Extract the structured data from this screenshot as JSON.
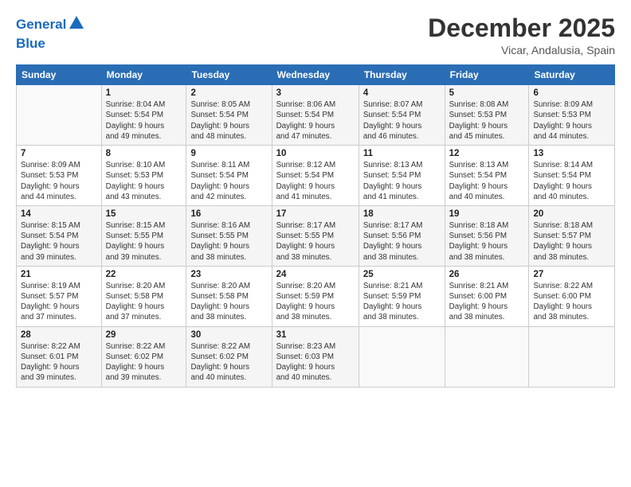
{
  "header": {
    "logo_line1": "General",
    "logo_line2": "Blue",
    "month": "December 2025",
    "location": "Vicar, Andalusia, Spain"
  },
  "weekdays": [
    "Sunday",
    "Monday",
    "Tuesday",
    "Wednesday",
    "Thursday",
    "Friday",
    "Saturday"
  ],
  "weeks": [
    [
      {
        "day": "",
        "info": ""
      },
      {
        "day": "1",
        "info": "Sunrise: 8:04 AM\nSunset: 5:54 PM\nDaylight: 9 hours\nand 49 minutes."
      },
      {
        "day": "2",
        "info": "Sunrise: 8:05 AM\nSunset: 5:54 PM\nDaylight: 9 hours\nand 48 minutes."
      },
      {
        "day": "3",
        "info": "Sunrise: 8:06 AM\nSunset: 5:54 PM\nDaylight: 9 hours\nand 47 minutes."
      },
      {
        "day": "4",
        "info": "Sunrise: 8:07 AM\nSunset: 5:54 PM\nDaylight: 9 hours\nand 46 minutes."
      },
      {
        "day": "5",
        "info": "Sunrise: 8:08 AM\nSunset: 5:53 PM\nDaylight: 9 hours\nand 45 minutes."
      },
      {
        "day": "6",
        "info": "Sunrise: 8:09 AM\nSunset: 5:53 PM\nDaylight: 9 hours\nand 44 minutes."
      }
    ],
    [
      {
        "day": "7",
        "info": "Sunrise: 8:09 AM\nSunset: 5:53 PM\nDaylight: 9 hours\nand 44 minutes."
      },
      {
        "day": "8",
        "info": "Sunrise: 8:10 AM\nSunset: 5:53 PM\nDaylight: 9 hours\nand 43 minutes."
      },
      {
        "day": "9",
        "info": "Sunrise: 8:11 AM\nSunset: 5:54 PM\nDaylight: 9 hours\nand 42 minutes."
      },
      {
        "day": "10",
        "info": "Sunrise: 8:12 AM\nSunset: 5:54 PM\nDaylight: 9 hours\nand 41 minutes."
      },
      {
        "day": "11",
        "info": "Sunrise: 8:13 AM\nSunset: 5:54 PM\nDaylight: 9 hours\nand 41 minutes."
      },
      {
        "day": "12",
        "info": "Sunrise: 8:13 AM\nSunset: 5:54 PM\nDaylight: 9 hours\nand 40 minutes."
      },
      {
        "day": "13",
        "info": "Sunrise: 8:14 AM\nSunset: 5:54 PM\nDaylight: 9 hours\nand 40 minutes."
      }
    ],
    [
      {
        "day": "14",
        "info": "Sunrise: 8:15 AM\nSunset: 5:54 PM\nDaylight: 9 hours\nand 39 minutes."
      },
      {
        "day": "15",
        "info": "Sunrise: 8:15 AM\nSunset: 5:55 PM\nDaylight: 9 hours\nand 39 minutes."
      },
      {
        "day": "16",
        "info": "Sunrise: 8:16 AM\nSunset: 5:55 PM\nDaylight: 9 hours\nand 38 minutes."
      },
      {
        "day": "17",
        "info": "Sunrise: 8:17 AM\nSunset: 5:55 PM\nDaylight: 9 hours\nand 38 minutes."
      },
      {
        "day": "18",
        "info": "Sunrise: 8:17 AM\nSunset: 5:56 PM\nDaylight: 9 hours\nand 38 minutes."
      },
      {
        "day": "19",
        "info": "Sunrise: 8:18 AM\nSunset: 5:56 PM\nDaylight: 9 hours\nand 38 minutes."
      },
      {
        "day": "20",
        "info": "Sunrise: 8:18 AM\nSunset: 5:57 PM\nDaylight: 9 hours\nand 38 minutes."
      }
    ],
    [
      {
        "day": "21",
        "info": "Sunrise: 8:19 AM\nSunset: 5:57 PM\nDaylight: 9 hours\nand 37 minutes."
      },
      {
        "day": "22",
        "info": "Sunrise: 8:20 AM\nSunset: 5:58 PM\nDaylight: 9 hours\nand 37 minutes."
      },
      {
        "day": "23",
        "info": "Sunrise: 8:20 AM\nSunset: 5:58 PM\nDaylight: 9 hours\nand 38 minutes."
      },
      {
        "day": "24",
        "info": "Sunrise: 8:20 AM\nSunset: 5:59 PM\nDaylight: 9 hours\nand 38 minutes."
      },
      {
        "day": "25",
        "info": "Sunrise: 8:21 AM\nSunset: 5:59 PM\nDaylight: 9 hours\nand 38 minutes."
      },
      {
        "day": "26",
        "info": "Sunrise: 8:21 AM\nSunset: 6:00 PM\nDaylight: 9 hours\nand 38 minutes."
      },
      {
        "day": "27",
        "info": "Sunrise: 8:22 AM\nSunset: 6:00 PM\nDaylight: 9 hours\nand 38 minutes."
      }
    ],
    [
      {
        "day": "28",
        "info": "Sunrise: 8:22 AM\nSunset: 6:01 PM\nDaylight: 9 hours\nand 39 minutes."
      },
      {
        "day": "29",
        "info": "Sunrise: 8:22 AM\nSunset: 6:02 PM\nDaylight: 9 hours\nand 39 minutes."
      },
      {
        "day": "30",
        "info": "Sunrise: 8:22 AM\nSunset: 6:02 PM\nDaylight: 9 hours\nand 40 minutes."
      },
      {
        "day": "31",
        "info": "Sunrise: 8:23 AM\nSunset: 6:03 PM\nDaylight: 9 hours\nand 40 minutes."
      },
      {
        "day": "",
        "info": ""
      },
      {
        "day": "",
        "info": ""
      },
      {
        "day": "",
        "info": ""
      }
    ]
  ]
}
